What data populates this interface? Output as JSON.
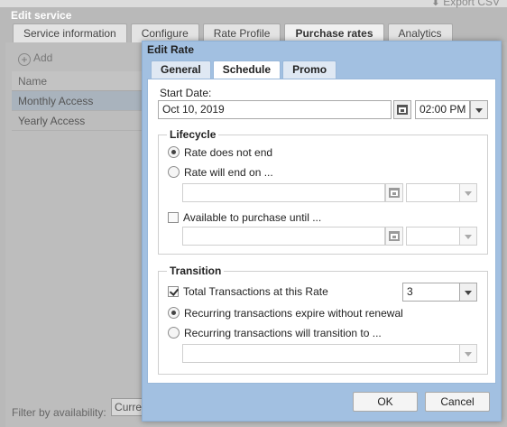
{
  "background": {
    "export_label": "Export CSV",
    "window_title": "Edit service",
    "tabs": [
      {
        "label": "Service information"
      },
      {
        "label": "Configure"
      },
      {
        "label": "Rate Profile"
      },
      {
        "label": "Purchase rates",
        "active": true
      },
      {
        "label": "Analytics"
      }
    ],
    "add_label": "Add",
    "grid": {
      "column_header": "Name",
      "rows": [
        "Monthly Access",
        "Yearly Access"
      ]
    },
    "footer": {
      "filter_label": "Filter by availability:",
      "filter_value": "Current"
    }
  },
  "dialog": {
    "title": "Edit Rate",
    "tabs": [
      {
        "label": "General"
      },
      {
        "label": "Schedule",
        "active": true
      },
      {
        "label": "Promo"
      }
    ],
    "start_date_label": "Start Date:",
    "start_date_value": "Oct 10, 2019",
    "start_time_value": "02:00 PM",
    "lifecycle": {
      "legend": "Lifecycle",
      "opt_not_end": "Rate does not end",
      "opt_will_end": "Rate will end on ...",
      "end_date_value": "",
      "end_time_value": "",
      "available_until_label": "Available to purchase until ...",
      "available_date_value": "",
      "available_time_value": "",
      "selected": "not_end",
      "available_checked": false
    },
    "transition": {
      "legend": "Transition",
      "total_tx_label": "Total Transactions at this Rate",
      "total_tx_checked": true,
      "total_tx_value": "3",
      "opt_expire": "Recurring transactions expire without renewal",
      "opt_transition": "Recurring transactions will transition to ...",
      "selected": "expire",
      "transition_target_value": ""
    },
    "ok_label": "OK",
    "cancel_label": "Cancel"
  },
  "colors": {
    "dialog_frame": "#a2c0e1",
    "overlay": "#b9b9b9"
  }
}
